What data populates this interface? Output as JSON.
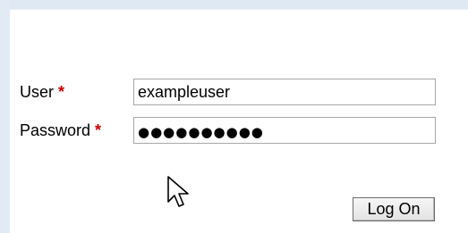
{
  "form": {
    "user_label": "User",
    "password_label": "Password",
    "required_marker": "*",
    "user_value": "exampleuser",
    "password_masked": "●●●●●●●●●●"
  },
  "actions": {
    "logon_label": "Log On"
  },
  "colors": {
    "required": "#cc0000",
    "frame": "#dfe9f4"
  },
  "cursor_icon": "arrow-cursor-icon"
}
